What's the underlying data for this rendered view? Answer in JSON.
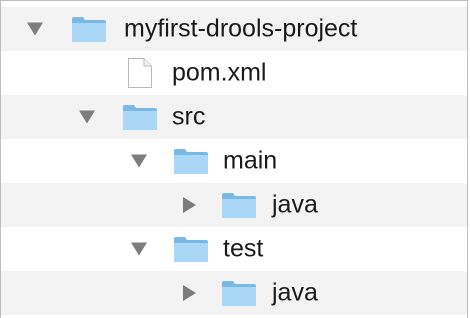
{
  "tree": {
    "rows": [
      {
        "label": "myfirst-drools-project",
        "kind": "folder",
        "expanded": true,
        "depth": 0
      },
      {
        "label": "pom.xml",
        "kind": "file",
        "depth": 1
      },
      {
        "label": "src",
        "kind": "folder",
        "expanded": true,
        "depth": 1
      },
      {
        "label": "main",
        "kind": "folder",
        "expanded": true,
        "depth": 2
      },
      {
        "label": "java",
        "kind": "folder",
        "expanded": false,
        "depth": 3
      },
      {
        "label": "test",
        "kind": "folder",
        "expanded": true,
        "depth": 2
      },
      {
        "label": "java",
        "kind": "folder",
        "expanded": false,
        "depth": 3
      }
    ]
  },
  "colors": {
    "folder_body": "#8cc8ef",
    "folder_front": "#a8d6f4",
    "disclosure": "#7d7d7d",
    "row_alt": "#f3f3f3"
  }
}
